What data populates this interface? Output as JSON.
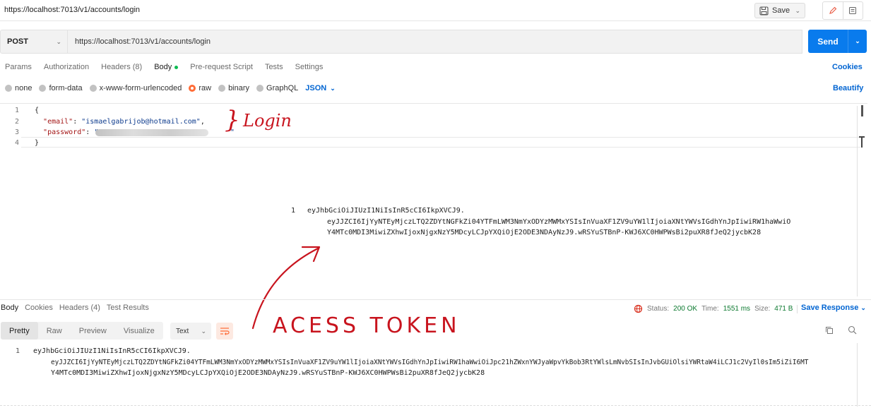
{
  "title_bar": {
    "title": "https://localhost:7013/v1/accounts/login",
    "save_label": "Save"
  },
  "request": {
    "method": "POST",
    "url": "https://localhost:7013/v1/accounts/login",
    "send_label": "Send"
  },
  "request_tabs": [
    "Params",
    "Authorization",
    "Headers (8)",
    "Body",
    "Pre-request Script",
    "Tests",
    "Settings"
  ],
  "cookies_label": "Cookies",
  "body_types": [
    "none",
    "form-data",
    "x-www-form-urlencoded",
    "raw",
    "binary",
    "GraphQL"
  ],
  "body_format": "JSON",
  "beautify_label": "Beautify",
  "editor": {
    "line_numbers": [
      "1",
      "2",
      "3",
      "4"
    ],
    "lines": [
      "{",
      "  \"email\": \"ismaelgabrijob@hotmail.com\",",
      "  \"password\": \"********************\"",
      "}"
    ],
    "email_key": "\"email\"",
    "email_value": "\"ismaelgabrijob@hotmail.com\"",
    "password_key": "\"password\""
  },
  "token_overlay": {
    "line_number": "1",
    "lines": [
      "eyJhbGciOiJIUzI1NiIsInR5cCI6IkpXVCJ9.",
      "eyJJZCI6IjYyNTEyMjczLTQ2ZDYtNGFkZi04YTFmLWM3NmYxODYzMWMxYSIsInVuaXF1ZV9uYW1lIjoiaXNtYWVsIGdhYnJpIiwiRW1haWwiO",
      "Y4MTc0MDI3MiwiZXhwIjoxNjgxNzY5MDcyLCJpYXQiOjE2ODE3NDAyNzJ9.wRSYuSTBnP-KWJ6XC0HWPWsBi2puXR8fJeQ2jycbK28"
    ]
  },
  "annotations": {
    "login": "} Login",
    "token": "ACESS TOKEN"
  },
  "response_tabs": [
    "Body",
    "Cookies",
    "Headers (4)",
    "Test Results"
  ],
  "response_stats": {
    "status_label": "Status:",
    "status": "200 OK",
    "time_label": "Time:",
    "time": "1551 ms",
    "size_label": "Size:",
    "size": "471 B"
  },
  "save_response_label": "Save Response",
  "view_modes": [
    "Pretty",
    "Raw",
    "Preview",
    "Visualize"
  ],
  "view_format": "Text",
  "response_body": {
    "line_number": "1",
    "lines": [
      "eyJhbGciOiJIUzI1NiIsInR5cCI6IkpXVCJ9.",
      "eyJJZCI6IjYyNTEyMjczLTQ2ZDYtNGFkZi04YTFmLWM3NmYxODYzMWMxYSIsInVuaXF1ZV9uYW1lIjoiaXNtYWVsIGdhYnJpIiwiRW1haWwiOiJpc21hZWxnYWJyaWpvYkBob3RtYWlsLmNvbSIsInJvbGUiOlsiYWRtaW4iLCJ1c2VyIl0sIm5iZiI6MT",
      "Y4MTc0MDI3MiwiZXhwIjoxNjgxNzY5MDcyLCJpYXQiOjE2ODE3NDAyNzJ9.wRSYuSTBnP-KWJ6XC0HWPWsBi2puXR8fJeQ2jycbK28"
    ]
  },
  "colors": {
    "accent": "#097bed",
    "brand_orange": "#ff6c37",
    "annotation_red": "#c8141e",
    "link_blue": "#0265d2"
  }
}
